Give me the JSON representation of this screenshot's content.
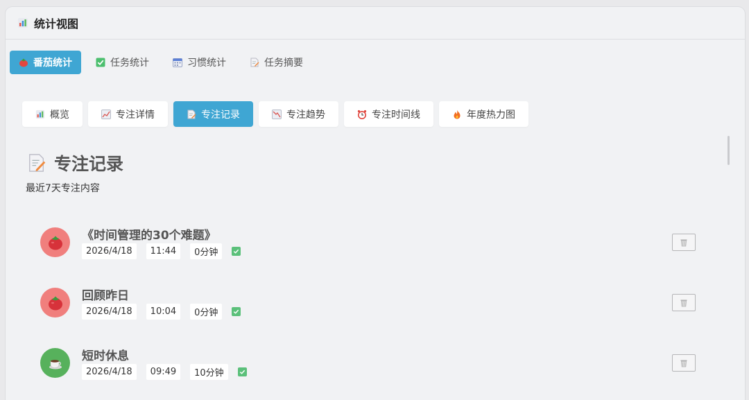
{
  "window": {
    "title": "统计视图"
  },
  "main_tabs": [
    {
      "label": "番茄统计",
      "active": true,
      "icon": "tomato-icon"
    },
    {
      "label": "任务统计",
      "active": false,
      "icon": "check-box-icon"
    },
    {
      "label": "习惯统计",
      "active": false,
      "icon": "calendar-icon"
    },
    {
      "label": "任务摘要",
      "active": false,
      "icon": "memo-icon"
    }
  ],
  "sub_tabs": [
    {
      "label": "概览",
      "active": false,
      "icon": "bar-chart-icon"
    },
    {
      "label": "专注详情",
      "active": false,
      "icon": "line-chart-icon"
    },
    {
      "label": "专注记录",
      "active": true,
      "icon": "memo-icon"
    },
    {
      "label": "专注趋势",
      "active": false,
      "icon": "trend-down-icon"
    },
    {
      "label": "专注时间线",
      "active": false,
      "icon": "alarm-clock-icon"
    },
    {
      "label": "年度热力图",
      "active": false,
      "icon": "fire-icon"
    }
  ],
  "section": {
    "title": "专注记录",
    "subtitle": "最近7天专注内容"
  },
  "records": [
    {
      "title": "《时间管理的30个难题》",
      "date": "2026/4/18",
      "time": "11:44",
      "duration": "0分钟",
      "kind": "tomato",
      "completed": true
    },
    {
      "title": "回顾昨日",
      "date": "2026/4/18",
      "time": "10:04",
      "duration": "0分钟",
      "kind": "tomato",
      "completed": true
    },
    {
      "title": "短时休息",
      "date": "2026/4/18",
      "time": "09:49",
      "duration": "10分钟",
      "kind": "rest",
      "completed": true
    }
  ],
  "colors": {
    "accent": "#3fa6d3",
    "tomato_avatar": "#f07f7d",
    "rest_avatar": "#57b15c",
    "check": "#5bc07a"
  }
}
